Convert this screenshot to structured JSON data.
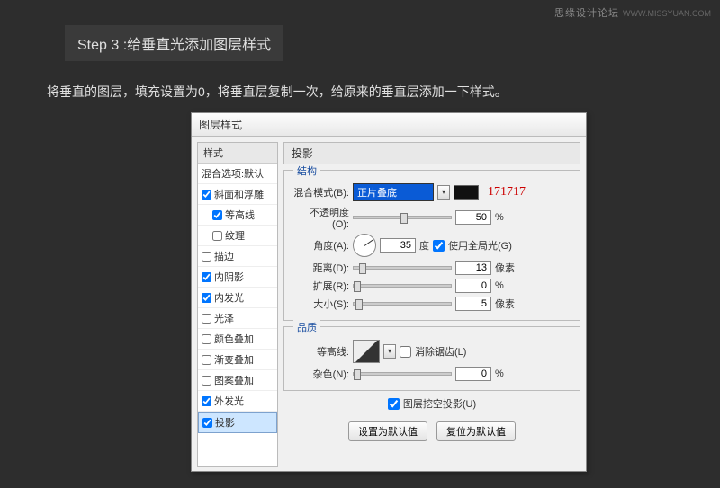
{
  "watermark": {
    "text": "思缘设计论坛",
    "url": "WWW.MISSYUAN.COM"
  },
  "step": {
    "title": "Step 3 :给垂直光添加图层样式",
    "desc": "将垂直的图层，填充设置为0，将垂直层复制一次，给原来的垂直层添加一下样式。"
  },
  "dialog": {
    "title": "图层样式"
  },
  "side": {
    "hdr": "样式",
    "blend": "混合选项:默认",
    "items": [
      {
        "label": "斜面和浮雕",
        "checked": true
      },
      {
        "label": "等高线",
        "checked": true,
        "indent": true
      },
      {
        "label": "纹理",
        "checked": false,
        "indent": true
      },
      {
        "label": "描边",
        "checked": false
      },
      {
        "label": "内阴影",
        "checked": true
      },
      {
        "label": "内发光",
        "checked": true
      },
      {
        "label": "光泽",
        "checked": false
      },
      {
        "label": "颜色叠加",
        "checked": false
      },
      {
        "label": "渐变叠加",
        "checked": false
      },
      {
        "label": "图案叠加",
        "checked": false
      },
      {
        "label": "外发光",
        "checked": true
      },
      {
        "label": "投影",
        "checked": true,
        "selected": true
      }
    ]
  },
  "panel": {
    "title": "投影",
    "structure": "结构",
    "blend_label": "混合模式(B):",
    "blend_mode": "正片叠底",
    "hex_note": "171717",
    "opacity_label": "不透明度(O):",
    "opacity_val": "50",
    "opacity_unit": "%",
    "angle_label": "角度(A):",
    "angle_val": "35",
    "angle_unit": "度",
    "global_label": "使用全局光(G)",
    "dist_label": "距离(D):",
    "dist_val": "13",
    "dist_unit": "像素",
    "spread_label": "扩展(R):",
    "spread_val": "0",
    "spread_unit": "%",
    "size_label": "大小(S):",
    "size_val": "5",
    "size_unit": "像素",
    "quality": "品质",
    "contour_label": "等高线:",
    "anti_label": "消除锯齿(L)",
    "noise_label": "杂色(N):",
    "noise_val": "0",
    "noise_unit": "%",
    "knockout_label": "图层挖空投影(U)",
    "btn_default": "设置为默认值",
    "btn_reset": "复位为默认值"
  }
}
